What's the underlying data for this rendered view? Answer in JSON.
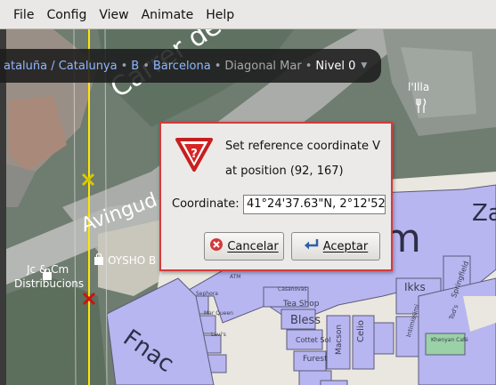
{
  "menubar": {
    "items": [
      "File",
      "Config",
      "View",
      "Animate",
      "Help"
    ]
  },
  "breadcrumb": {
    "items": [
      {
        "label": "ataluña / Catalunya",
        "style": "link"
      },
      {
        "label": "B",
        "style": "link"
      },
      {
        "label": "Barcelona",
        "style": "link"
      },
      {
        "label": "Diagonal Mar",
        "style": "muted"
      },
      {
        "label": "Nivel 0",
        "style": "current"
      }
    ],
    "separator": "•",
    "dropdown_icon": "caret-down-icon"
  },
  "map": {
    "street_labels": [
      "Carrer de",
      "Avingud"
    ],
    "poi_labels": {
      "jc_cm_line1": "Jc & Cm",
      "jc_cm_line2": "Distribucions",
      "oysho": "OYSHO B",
      "illa": "l'Illa",
      "za": "Za",
      "fnac": "Fnac",
      "m_big": "m"
    },
    "shop_labels": [
      "Ikks",
      "Bless",
      "Tea Shop",
      "Cottet Sol",
      "Furest",
      "Celio",
      "Macson",
      "Springfield",
      "Tod's",
      "Intimissimi",
      "Khenyan Café",
      "Casanovas",
      "ATM",
      "Sephora",
      "Mar Queen",
      "Levi's"
    ],
    "markers": {
      "yellow_marker": "x-marker-icon",
      "red_marker": "x-marker-icon"
    },
    "colors": {
      "mall_fill": "#b8b6f0",
      "reference_line": "#ffe600",
      "red_marker": "#cc1111",
      "yellow_marker": "#d6c800"
    }
  },
  "dialog": {
    "title_line1": "Set reference coordinate V",
    "title_line2": "at position (92, 167)",
    "coordinate_label": "Coordinate:",
    "coordinate_value": "41°24'37.63\"N, 2°12'52",
    "cancel_label": "Cancelar",
    "accept_label": "Aceptar",
    "icon": "warning-question-icon",
    "border_color": "#d43b3b"
  }
}
